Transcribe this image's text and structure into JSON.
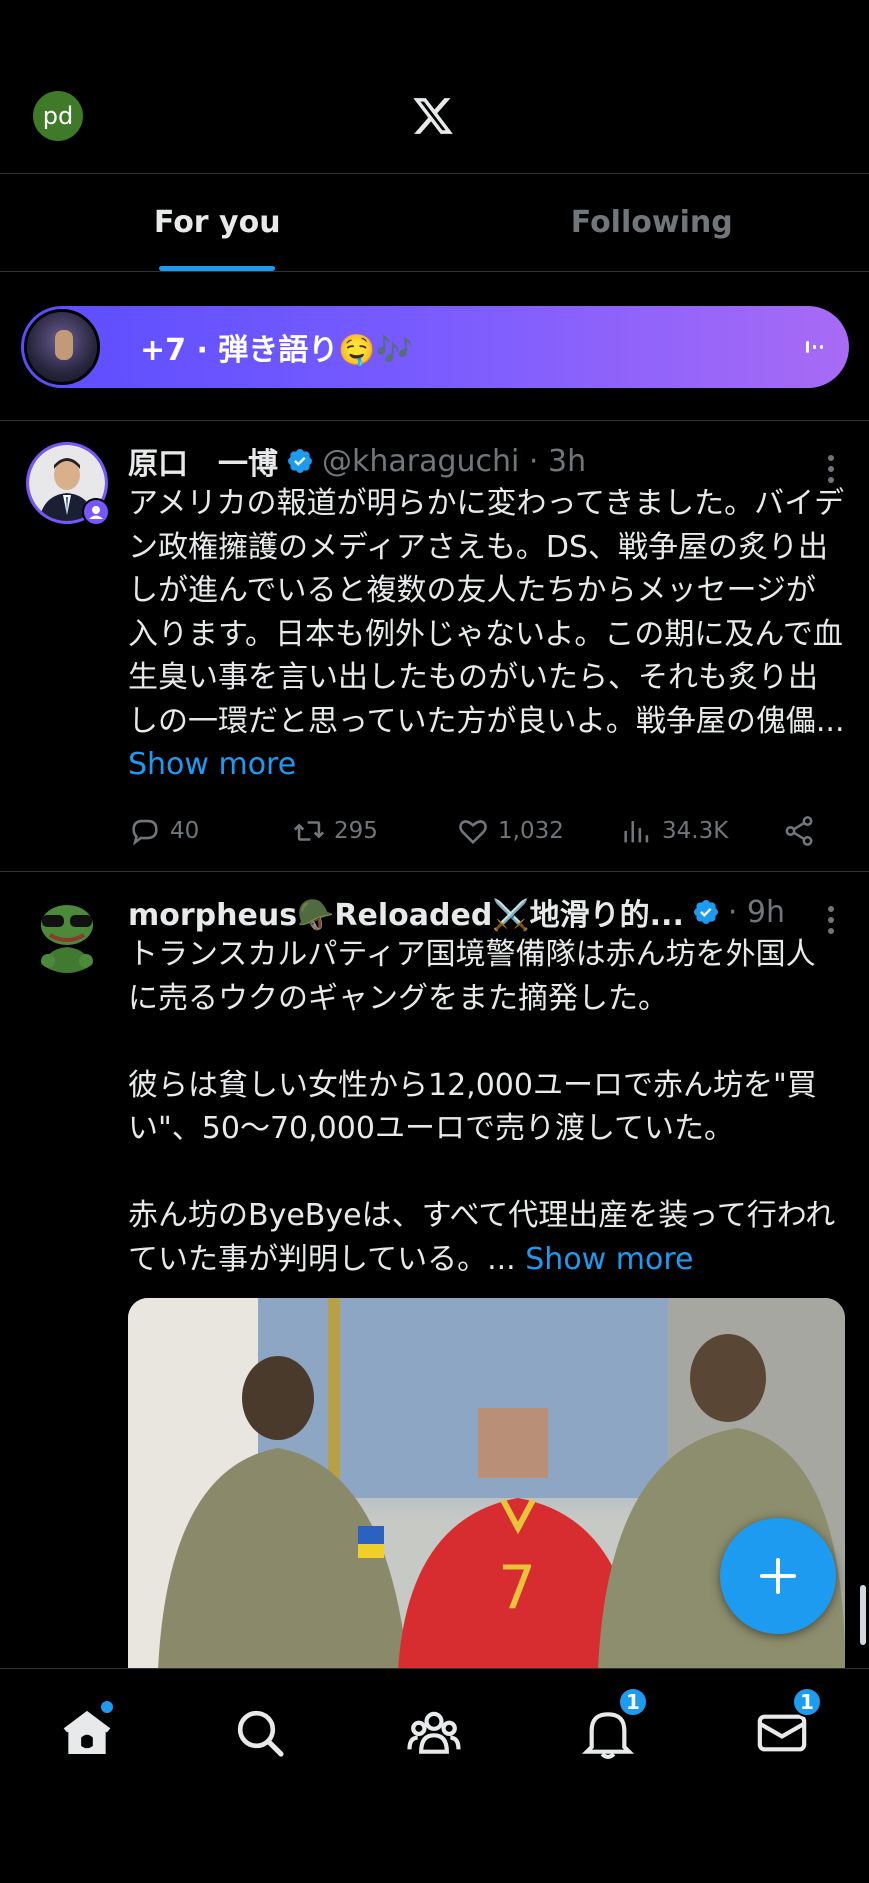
{
  "header": {
    "avatar_initials": "pd",
    "logo": "x-logo"
  },
  "tabs": [
    {
      "label": "For you",
      "active": true
    },
    {
      "label": "Following",
      "active": false
    }
  ],
  "spaces": {
    "label": "+7 · 弾き語り🤤🎶",
    "icon": "audio-bars-icon"
  },
  "tweets": [
    {
      "name": "原口　一博",
      "handle": "@kharaguchi",
      "time": "3h",
      "text": "アメリカの報道が明らかに変わってきました。バイデン政権擁護のメディアさえも。DS、戦争屋の炙り出しが進んでいると複数の友人たちからメッセージが入ります。日本も例外じゃないよ。この期に及んで血生臭い事を言い出したものがいたら、それも炙り出しの一環だと思っていた方が良いよ。戦争屋の傀儡...",
      "show_more": "Show more",
      "replies": "40",
      "reposts": "295",
      "likes": "1,032",
      "views": "34.3K"
    },
    {
      "name": "morpheus🪖Reloaded⚔️地滑り的...",
      "time": "9h",
      "text": "トランスカルパティア国境警備隊は赤ん坊を外国人に売るウクのギャングをまた摘発した。\n\n彼らは貧しい女性から12,000ユーロで赤ん坊を\"買い\"、50〜70,000ユーロで売り渡していた。\n\n赤ん坊のByeByeは、すべて代理出産を装って行われていた事が判明している。...",
      "show_more": "Show more"
    }
  ],
  "nav": {
    "notifications_badge": "1",
    "messages_badge": "1"
  },
  "colors": {
    "accent": "#1d9bf0",
    "background": "#000000",
    "muted": "#71767b"
  }
}
